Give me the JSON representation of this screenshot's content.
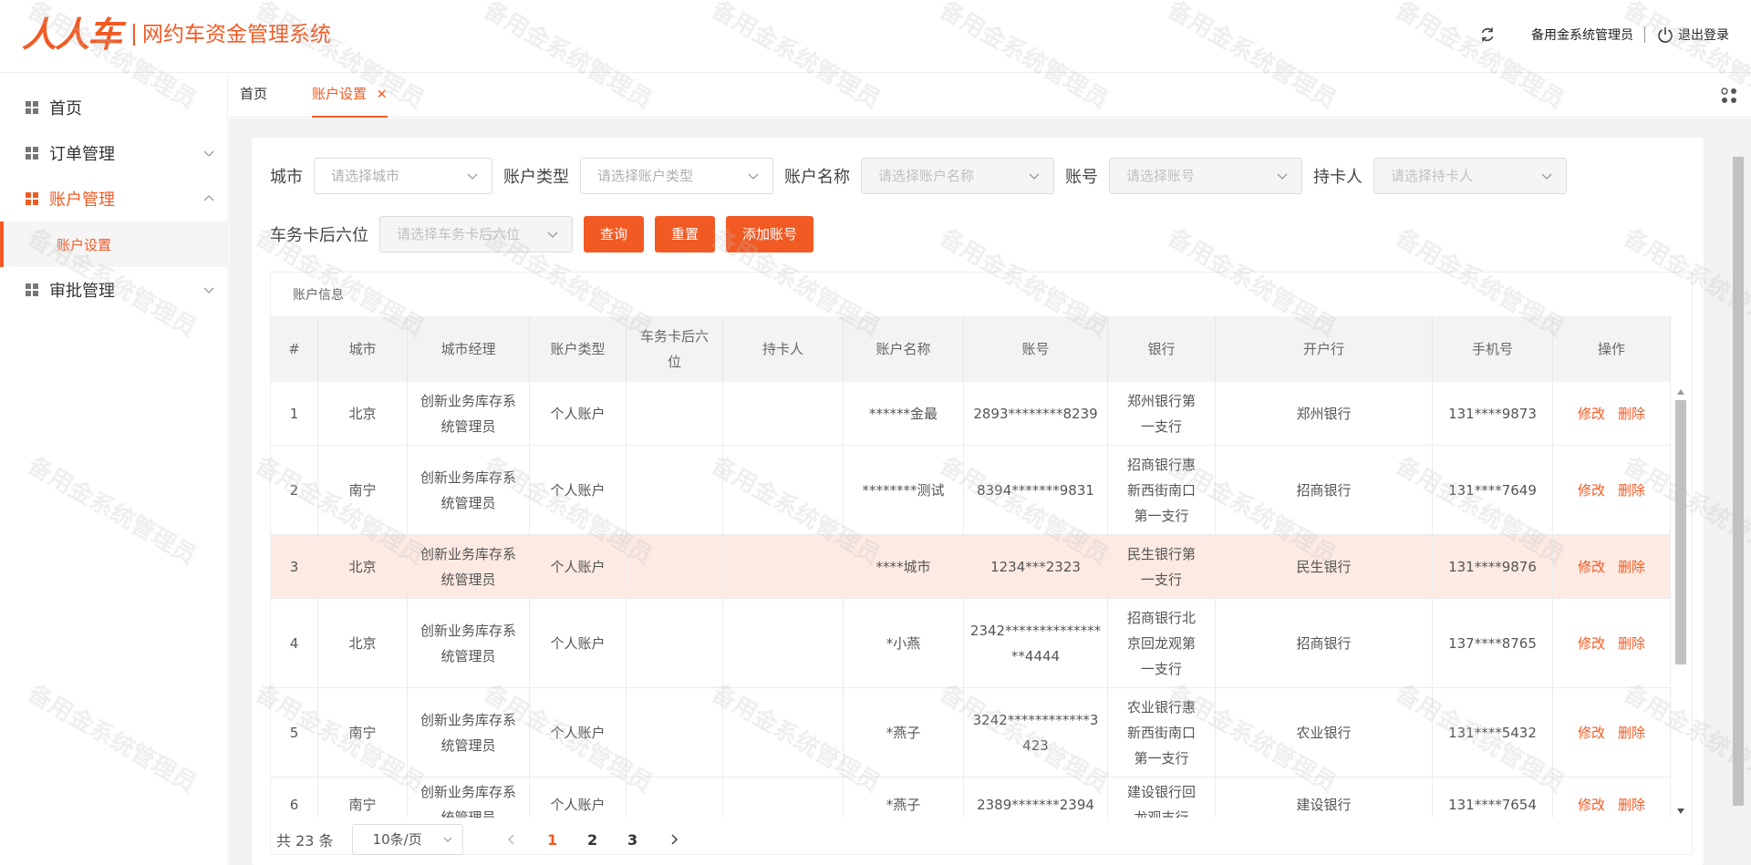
{
  "app": {
    "logo_text": "人人车",
    "title": "网约车资金管理系统",
    "user_name": "备用金系统管理员",
    "logout_label": "退出登录",
    "accent": "#f25a24"
  },
  "sidebar": {
    "items": [
      {
        "label": "首页"
      },
      {
        "label": "订单管理"
      },
      {
        "label": "账户管理"
      },
      {
        "label": "账户设置"
      },
      {
        "label": "审批管理"
      }
    ]
  },
  "tabs": [
    {
      "label": "首页"
    },
    {
      "label": "账户设置"
    }
  ],
  "filters": {
    "city_label": "城市",
    "city_placeholder": "请选择城市",
    "type_label": "账户类型",
    "type_placeholder": "请选择账户类型",
    "name_label": "账户名称",
    "name_placeholder": "请选择账户名称",
    "account_label": "账号",
    "account_placeholder": "请选择账号",
    "holder_label": "持卡人",
    "holder_placeholder": "请选择持卡人",
    "card_label": "车务卡后六位",
    "card_placeholder": "请选择车务卡后六位",
    "query_button": "查询",
    "reset_button": "重置",
    "add_button": "添加账号"
  },
  "table": {
    "caption": "账户信息",
    "headers": [
      "#",
      "城市",
      "城市经理",
      "账户类型",
      "车务卡后六位",
      "持卡人",
      "账户名称",
      "账号",
      "银行",
      "开户行",
      "手机号",
      "操作"
    ],
    "edit_label": "修改",
    "delete_label": "删除",
    "rows": [
      {
        "no": "1",
        "city": "北京",
        "manager": "创新业务库存系统管理员",
        "type": "个人账户",
        "card": "",
        "holder": "",
        "name": "******金最",
        "account": "2893********8239",
        "bank": "郑州银行第一支行",
        "branch": "郑州银行",
        "phone": "131****9873"
      },
      {
        "no": "2",
        "city": "南宁",
        "manager": "创新业务库存系统管理员",
        "type": "个人账户",
        "card": "",
        "holder": "",
        "name": "********测试",
        "account": "8394*******9831",
        "bank": "招商银行惠新西街南口第一支行",
        "branch": "招商银行",
        "phone": "131****7649"
      },
      {
        "no": "3",
        "city": "北京",
        "manager": "创新业务库存系统管理员",
        "type": "个人账户",
        "card": "",
        "holder": "",
        "name": "****城市",
        "account": "1234***2323",
        "bank": "民生银行第一支行",
        "branch": "民生银行",
        "phone": "131****9876"
      },
      {
        "no": "4",
        "city": "北京",
        "manager": "创新业务库存系统管理员",
        "type": "个人账户",
        "card": "",
        "holder": "",
        "name": "*小燕",
        "account": "2342****************4444",
        "bank": "招商银行北京回龙观第一支行",
        "branch": "招商银行",
        "phone": "137****8765"
      },
      {
        "no": "5",
        "city": "南宁",
        "manager": "创新业务库存系统管理员",
        "type": "个人账户",
        "card": "",
        "holder": "",
        "name": "*燕子",
        "account": "3242************3423",
        "bank": "农业银行惠新西街南口第一支行",
        "branch": "农业银行",
        "phone": "131****5432"
      },
      {
        "no": "6",
        "city": "南宁",
        "manager": "创新业务库存系统管理员",
        "type": "个人账户",
        "card": "",
        "holder": "",
        "name": "*燕子",
        "account": "2389*******2394",
        "bank": "建设银行回龙观支行",
        "branch": "建设银行",
        "phone": "131****7654"
      }
    ]
  },
  "pagination": {
    "total": "共 23 条",
    "page_size": "10条/页",
    "pages": [
      "1",
      "2",
      "3"
    ]
  },
  "watermark": "备用金系统管理员"
}
